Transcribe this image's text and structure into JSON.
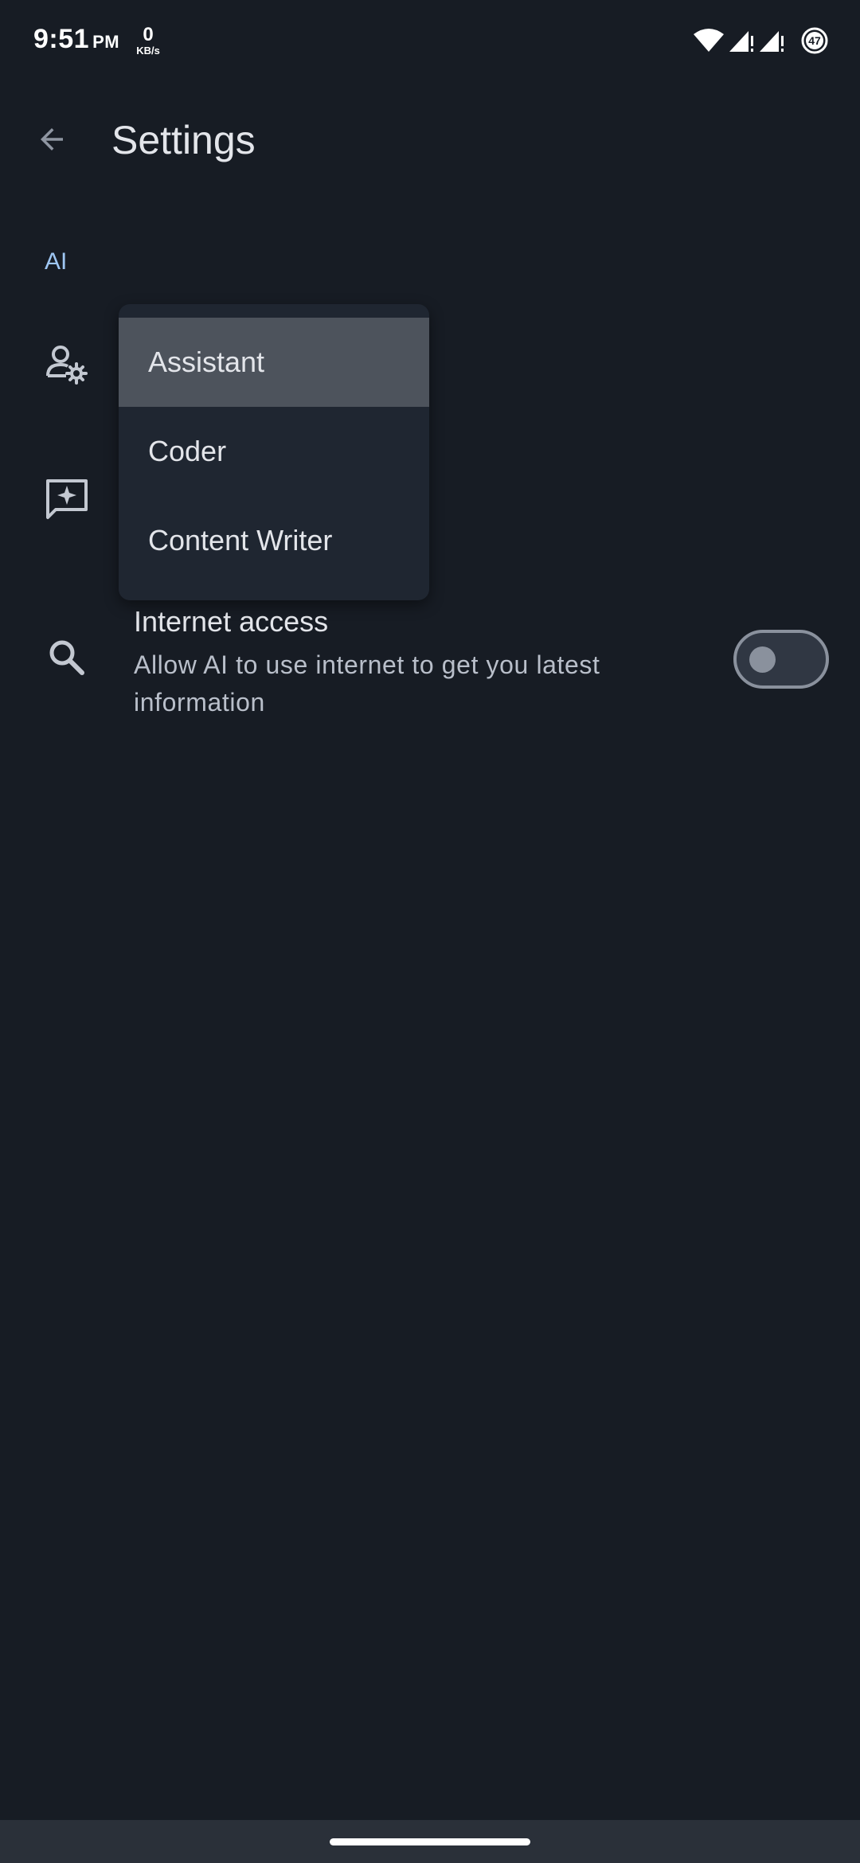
{
  "status_bar": {
    "time": "9:51",
    "ampm": "PM",
    "net_speed_value": "0",
    "net_speed_unit": "KB/s",
    "battery_level": "47",
    "icons": [
      "wifi-icon",
      "signal-icon",
      "signal-icon",
      "battery-icon"
    ]
  },
  "app_bar": {
    "title": "Settings",
    "back_icon": "arrow-back-icon"
  },
  "section": {
    "label": "AI"
  },
  "settings": {
    "persona_icon": "person-gear-icon",
    "prompt_icon": "chat-sparkle-icon",
    "internet": {
      "icon": "search-icon",
      "title": "Internet access",
      "description": "Allow AI to use internet to get you latest information",
      "enabled": false
    }
  },
  "dropdown": {
    "items": [
      {
        "label": "Assistant",
        "selected": true
      },
      {
        "label": "Coder",
        "selected": false
      },
      {
        "label": "Content Writer",
        "selected": false
      }
    ]
  },
  "colors": {
    "background": "#171c24",
    "accent": "#9ec6f2",
    "menu_background": "#1f2631",
    "menu_selected": "#4d535c"
  }
}
